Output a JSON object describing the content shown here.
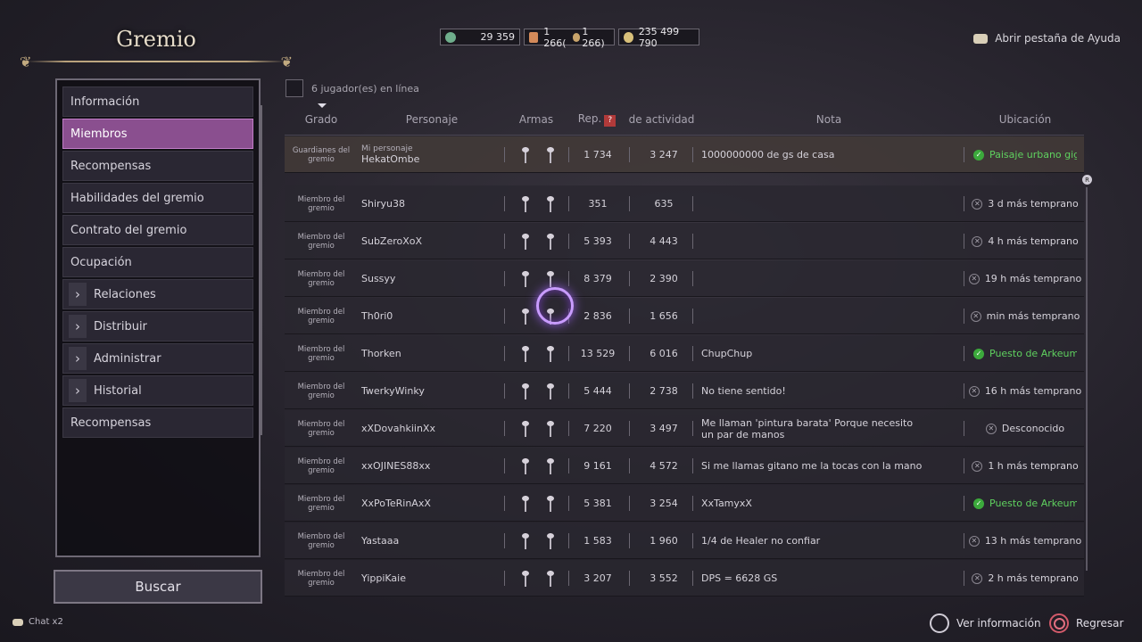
{
  "header": {
    "title": "Gremio",
    "resources": [
      {
        "icon": "silver-coin-icon",
        "value": "29 359",
        "color": "#6fae8c"
      },
      {
        "icon": "contribution-icon",
        "value": "1 266(",
        "value_b": "1 266)",
        "color": "#d38a5a"
      },
      {
        "icon": "gold-coin-icon",
        "value": "235 499 790",
        "color": "#d8c07a"
      }
    ],
    "help_label": "Abrir pestaña de Ayuda"
  },
  "sidebar": {
    "items": [
      {
        "label": "Información",
        "chevron": false,
        "active": false
      },
      {
        "label": "Miembros",
        "chevron": false,
        "active": true
      },
      {
        "label": "Recompensas",
        "chevron": false,
        "active": false
      },
      {
        "label": "Habilidades del gremio",
        "chevron": false,
        "active": false
      },
      {
        "label": "Contrato del gremio",
        "chevron": false,
        "active": false
      },
      {
        "label": "Ocupación",
        "chevron": false,
        "active": false
      },
      {
        "label": "Relaciones",
        "chevron": true,
        "active": false
      },
      {
        "label": "Distribuir",
        "chevron": true,
        "active": false
      },
      {
        "label": "Administrar",
        "chevron": true,
        "active": false
      },
      {
        "label": "Historial",
        "chevron": true,
        "active": false
      },
      {
        "label": "Recompensas",
        "chevron": false,
        "active": false
      }
    ],
    "search_label": "Buscar"
  },
  "members": {
    "online_text": "6 jugador(es) en línea",
    "columns": {
      "grade": "Grado",
      "character": "Personaje",
      "weapons": "Armas",
      "rep": "Rep.",
      "rep_help": "?",
      "activity": "de actividad",
      "note": "Nota",
      "location": "Ubicación"
    },
    "rows": [
      {
        "grade": "Guardianes del gremio",
        "sub": "Mi personaje",
        "name": "HekatOmbe",
        "rep": "1 734",
        "activity": "3 247",
        "note": "1000000000 de gs de casa",
        "location": "Paisaje urbano gig",
        "online": true,
        "me": true
      },
      {
        "grade": "Miembro del gremio",
        "sub": "",
        "name": "Shiryu38",
        "rep": "351",
        "activity": "635",
        "note": "",
        "location": "3 d más temprano",
        "online": false,
        "me": false
      },
      {
        "grade": "Miembro del gremio",
        "sub": "",
        "name": "SubZeroXoX",
        "rep": "5 393",
        "activity": "4 443",
        "note": "",
        "location": "4 h más temprano",
        "online": false,
        "me": false
      },
      {
        "grade": "Miembro del gremio",
        "sub": "",
        "name": "Sussyy",
        "rep": "8 379",
        "activity": "2 390",
        "note": "",
        "location": "19 h más temprano",
        "online": false,
        "me": false
      },
      {
        "grade": "Miembro del gremio",
        "sub": "",
        "name": "Th0ri0",
        "rep": "2 836",
        "activity": "1 656",
        "note": "",
        "location": "min más temprano",
        "online": false,
        "me": false
      },
      {
        "grade": "Miembro del gremio",
        "sub": "",
        "name": "Thorken",
        "rep": "13 529",
        "activity": "6 016",
        "note": "ChupChup",
        "location": "Puesto de Arkeum",
        "online": true,
        "me": false
      },
      {
        "grade": "Miembro del gremio",
        "sub": "",
        "name": "TwerkyWinky",
        "rep": "5 444",
        "activity": "2 738",
        "note": "No tiene sentido!",
        "location": "16 h más temprano",
        "online": false,
        "me": false
      },
      {
        "grade": "Miembro del gremio",
        "sub": "",
        "name": "xXDovahkiinXx",
        "rep": "7 220",
        "activity": "3 497",
        "note": "Me llaman 'pintura barata' Porque necesito un par de manos",
        "location": "Desconocido",
        "online": false,
        "me": false
      },
      {
        "grade": "Miembro del gremio",
        "sub": "",
        "name": "xxOJINES88xx",
        "rep": "9 161",
        "activity": "4 572",
        "note": "Si me llamas gitano me la tocas con la mano",
        "location": "1 h más temprano",
        "online": false,
        "me": false
      },
      {
        "grade": "Miembro del gremio",
        "sub": "",
        "name": "XxPoTeRinAxX",
        "rep": "5 381",
        "activity": "3 254",
        "note": "XxTamyxX",
        "location": "Puesto de Arkeum",
        "online": true,
        "me": false
      },
      {
        "grade": "Miembro del gremio",
        "sub": "",
        "name": "Yastaaa",
        "rep": "1 583",
        "activity": "1 960",
        "note": "1/4 de Healer no confiar",
        "location": "13 h más temprano",
        "online": false,
        "me": false
      },
      {
        "grade": "Miembro del gremio",
        "sub": "",
        "name": "YippiKaie",
        "rep": "3 207",
        "activity": "3 552",
        "note": "DPS = 6628 GS",
        "location": "2 h más temprano",
        "online": false,
        "me": false
      }
    ]
  },
  "footer": {
    "chat_label": "Chat x2",
    "view_info_label": "Ver información",
    "back_label": "Regresar"
  },
  "scroll_marker": "R"
}
